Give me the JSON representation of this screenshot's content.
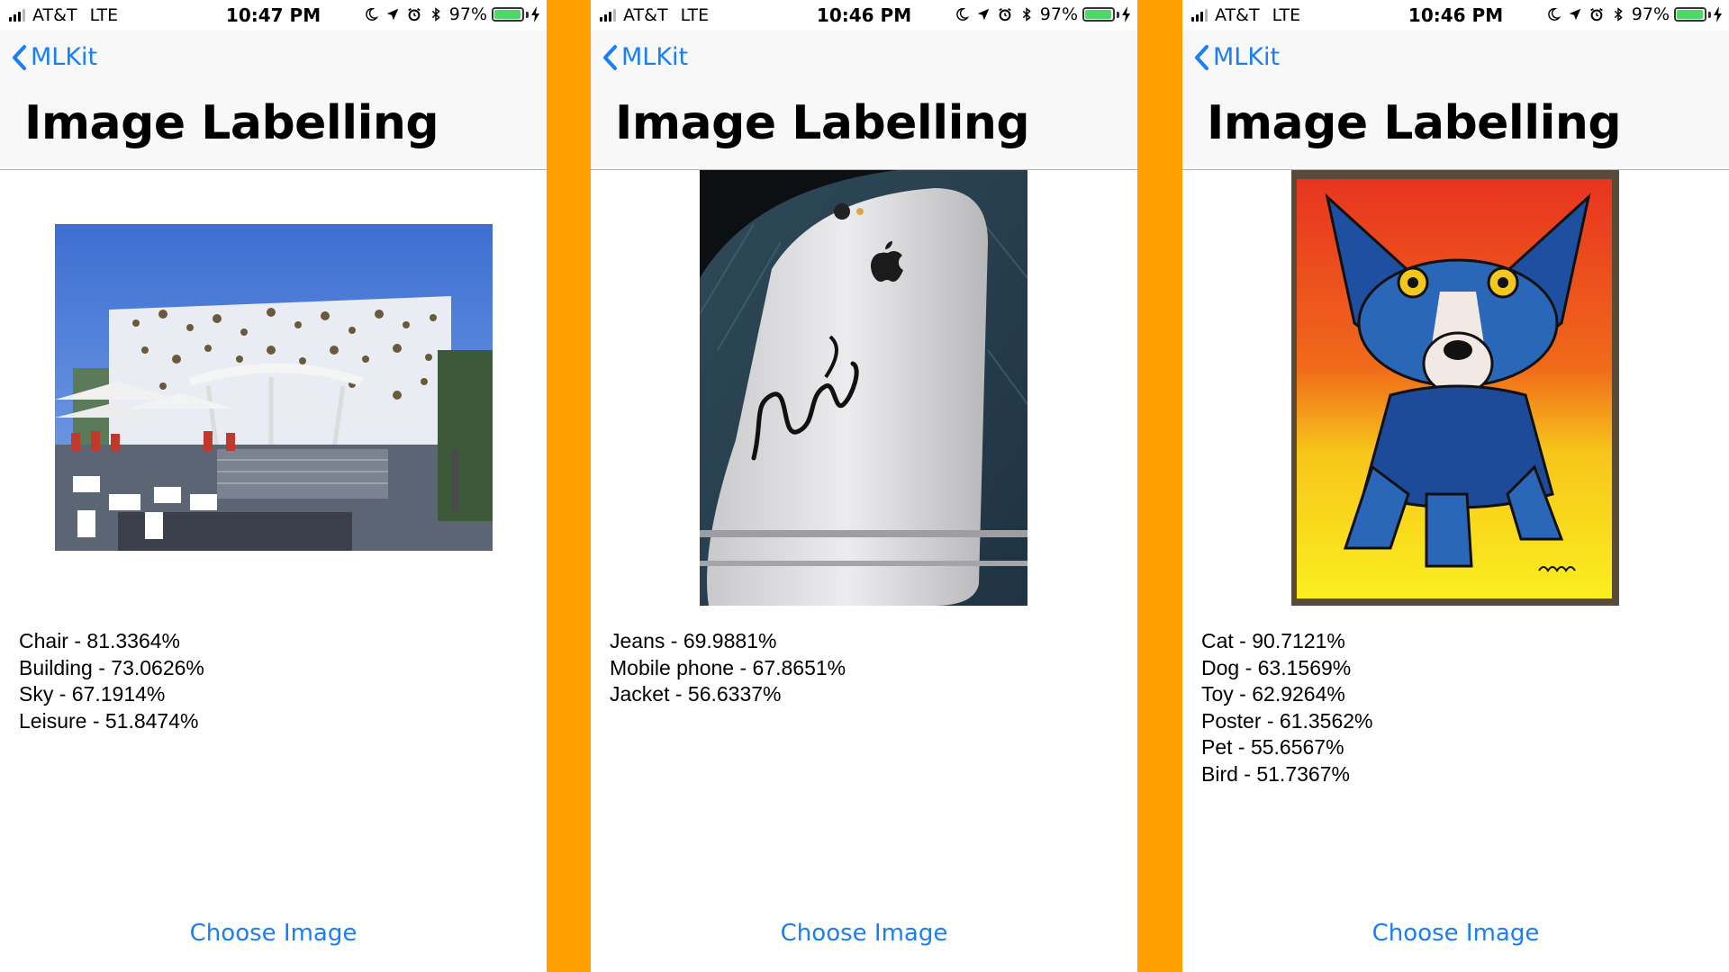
{
  "colors": {
    "divider_orange": "#FFA000",
    "link_blue": "#1a7ff5",
    "battery_green": "#4CD964"
  },
  "screens": [
    {
      "status": {
        "carrier": "AT&T",
        "network": "LTE",
        "time": "10:47 PM",
        "battery": "97%",
        "battery_level": 0.97
      },
      "nav": {
        "back_label": "MLKit",
        "title": "Image Labelling"
      },
      "image_subject": "outdoor plaza with building mural, umbrellas and chairs",
      "results": [
        "Chair - 81.3364%",
        "Building - 73.0626%",
        "Sky - 67.1914%",
        "Leisure - 51.8474%"
      ],
      "choose_label": "Choose Image"
    },
    {
      "status": {
        "carrier": "AT&T",
        "network": "LTE",
        "time": "10:46 PM",
        "battery": "97%",
        "battery_level": 0.97
      },
      "nav": {
        "back_label": "MLKit",
        "title": "Image Labelling"
      },
      "image_subject": "silver iPhone on denim jacket",
      "results": [
        "Jeans - 69.9881%",
        "Mobile phone - 67.8651%",
        "Jacket - 56.6337%"
      ],
      "choose_label": "Choose Image"
    },
    {
      "status": {
        "carrier": "AT&T",
        "network": "LTE",
        "time": "10:46 PM",
        "battery": "97%",
        "battery_level": 0.97
      },
      "nav": {
        "back_label": "MLKit",
        "title": "Image Labelling"
      },
      "image_subject": "blue dog painting",
      "results": [
        "Cat - 90.7121%",
        "Dog - 63.1569%",
        "Toy - 62.9264%",
        "Poster - 61.3562%",
        "Pet - 55.6567%",
        "Bird - 51.7367%"
      ],
      "choose_label": "Choose Image"
    }
  ]
}
